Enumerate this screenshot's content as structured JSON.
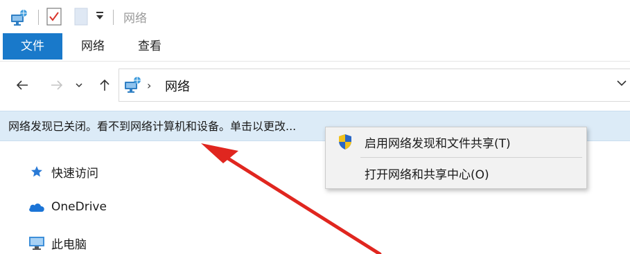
{
  "window": {
    "title": "网络"
  },
  "ribbon": {
    "tabs": [
      {
        "label": "文件",
        "active": true
      },
      {
        "label": "网络",
        "active": false
      },
      {
        "label": "查看",
        "active": false
      }
    ]
  },
  "navigation": {
    "address_path": [
      "网络"
    ],
    "breadcrumb_separator": "›"
  },
  "infobar": {
    "message": "网络发现已关闭。看不到网络计算机和设备。单击以更改..."
  },
  "sidebar": {
    "items": [
      {
        "label": "快速访问",
        "icon": "star-icon"
      },
      {
        "label": "OneDrive",
        "icon": "cloud-icon"
      },
      {
        "label": "此电脑",
        "icon": "computer-icon"
      }
    ]
  },
  "context_menu": {
    "items": [
      {
        "label": "启用网络发现和文件共享(T)",
        "icon": "uac-shield-icon"
      },
      {
        "label": "打开网络和共享中心(O)",
        "icon": ""
      }
    ]
  },
  "colors": {
    "accent": "#1979ca",
    "infobar_bg": "#dcebf7",
    "annotation_arrow": "#e0261f"
  }
}
